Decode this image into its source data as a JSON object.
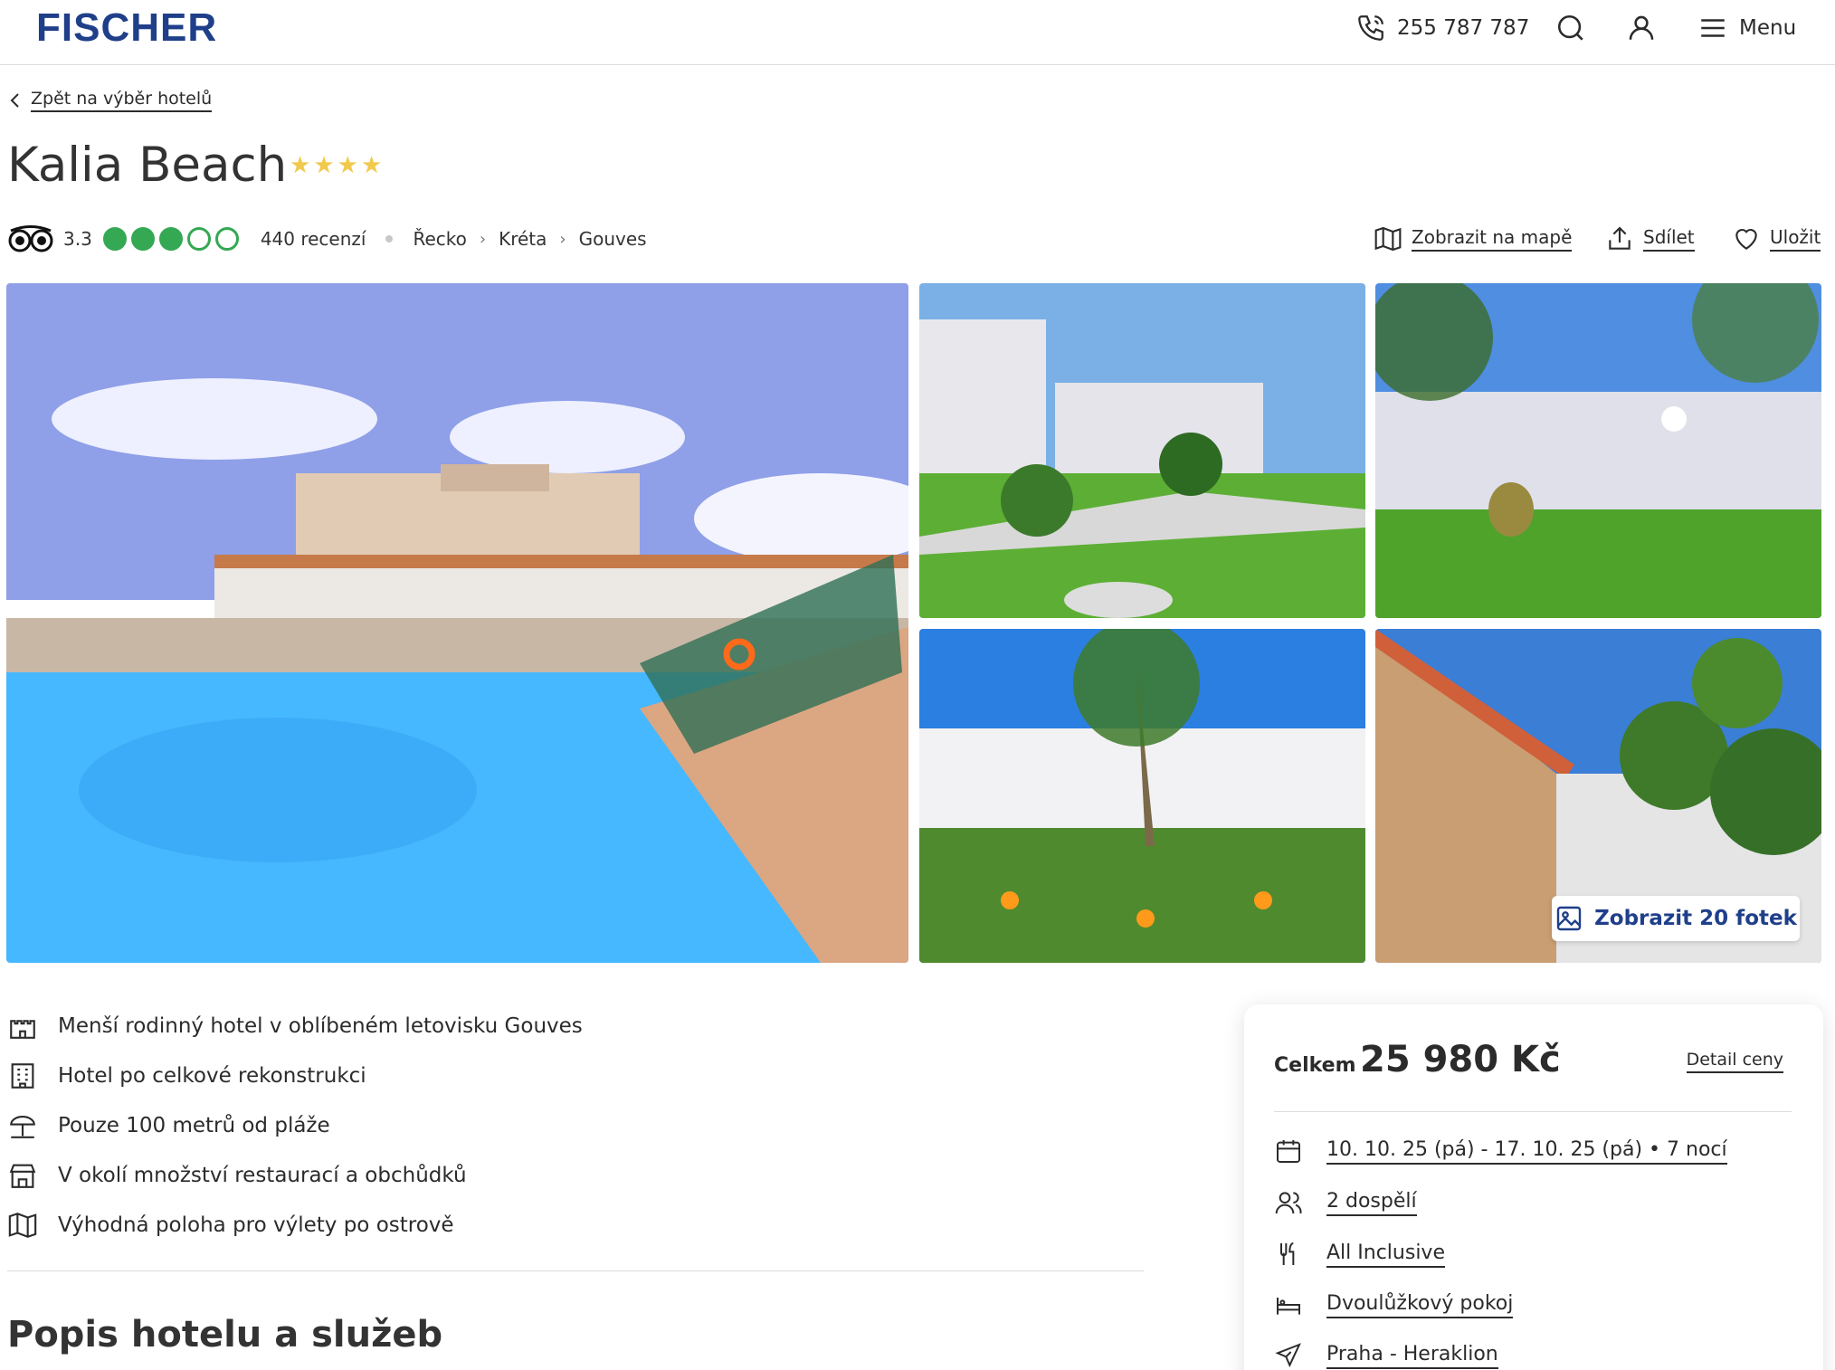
{
  "header": {
    "logo": "FISCHER",
    "phone": "255 787 787",
    "menu_label": "Menu"
  },
  "back_link": "Zpět na výběr hotelů",
  "hotel": {
    "name": "Kalia Beach",
    "stars": 4
  },
  "rating": {
    "score": "3.3",
    "bubbles_filled": 3,
    "bubbles_total": 5,
    "reviews": "440 recenzí"
  },
  "breadcrumb": [
    "Řecko",
    "Kréta",
    "Gouves"
  ],
  "actions": {
    "map": "Zobrazit na mapě",
    "share": "Sdílet",
    "save": "Uložit"
  },
  "gallery": {
    "photos_button": "Zobrazit 20 fotek"
  },
  "features": [
    {
      "icon": "castle-icon",
      "text": "Menší rodinný hotel v oblíbeném letovisku Gouves"
    },
    {
      "icon": "building-icon",
      "text": "Hotel po celkové rekonstrukci"
    },
    {
      "icon": "beach-umbrella-icon",
      "text": "Pouze 100 metrů od pláže"
    },
    {
      "icon": "store-icon",
      "text": "V okolí množství restaurací a obchůdků"
    },
    {
      "icon": "map-icon",
      "text": "Výhodná poloha pro výlety po ostrově"
    }
  ],
  "section_title": "Popis hotelu a služeb",
  "price_card": {
    "total_label": "Celkem",
    "total_value": "25 980 Kč",
    "detail_link": "Detail ceny",
    "dates": "10. 10. 25 (pá) - 17. 10. 25 (pá) • 7 nocí",
    "travelers": "2 dospělí",
    "board": "All Inclusive",
    "room": "Dvoulůžkový pokoj",
    "flight": "Praha - Heraklion"
  },
  "colors": {
    "brand": "#1f3f8a",
    "stars": "#f2c94c",
    "rating": "#34a853"
  }
}
